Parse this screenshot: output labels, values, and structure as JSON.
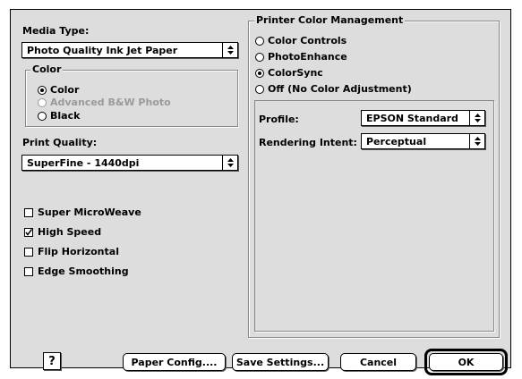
{
  "media_type": {
    "label": "Media Type:",
    "selected": "Photo Quality Ink Jet Paper"
  },
  "color_group": {
    "title": "Color",
    "options": [
      {
        "label": "Color",
        "selected": true,
        "disabled": false
      },
      {
        "label": "Advanced B&W Photo",
        "selected": false,
        "disabled": true
      },
      {
        "label": "Black",
        "selected": false,
        "disabled": false
      }
    ]
  },
  "print_quality": {
    "label": "Print Quality:",
    "selected": "SuperFine - 1440dpi"
  },
  "checkboxes": [
    {
      "label": "Super MicroWeave",
      "checked": false
    },
    {
      "label": "High Speed",
      "checked": true
    },
    {
      "label": "Flip Horizontal",
      "checked": false
    },
    {
      "label": "Edge Smoothing",
      "checked": false
    }
  ],
  "color_management": {
    "title": "Printer Color Management",
    "options": [
      {
        "label": "Color Controls",
        "selected": false
      },
      {
        "label": "PhotoEnhance",
        "selected": false
      },
      {
        "label": "ColorSync",
        "selected": true
      },
      {
        "label": "Off (No Color Adjustment)",
        "selected": false
      }
    ],
    "profile_label": "Profile:",
    "profile_value": "EPSON Standard",
    "intent_label": "Rendering Intent:",
    "intent_value": "Perceptual"
  },
  "buttons": {
    "help": "?",
    "paper_config": "Paper Config....",
    "save_settings": "Save Settings...",
    "cancel": "Cancel",
    "ok": "OK"
  }
}
